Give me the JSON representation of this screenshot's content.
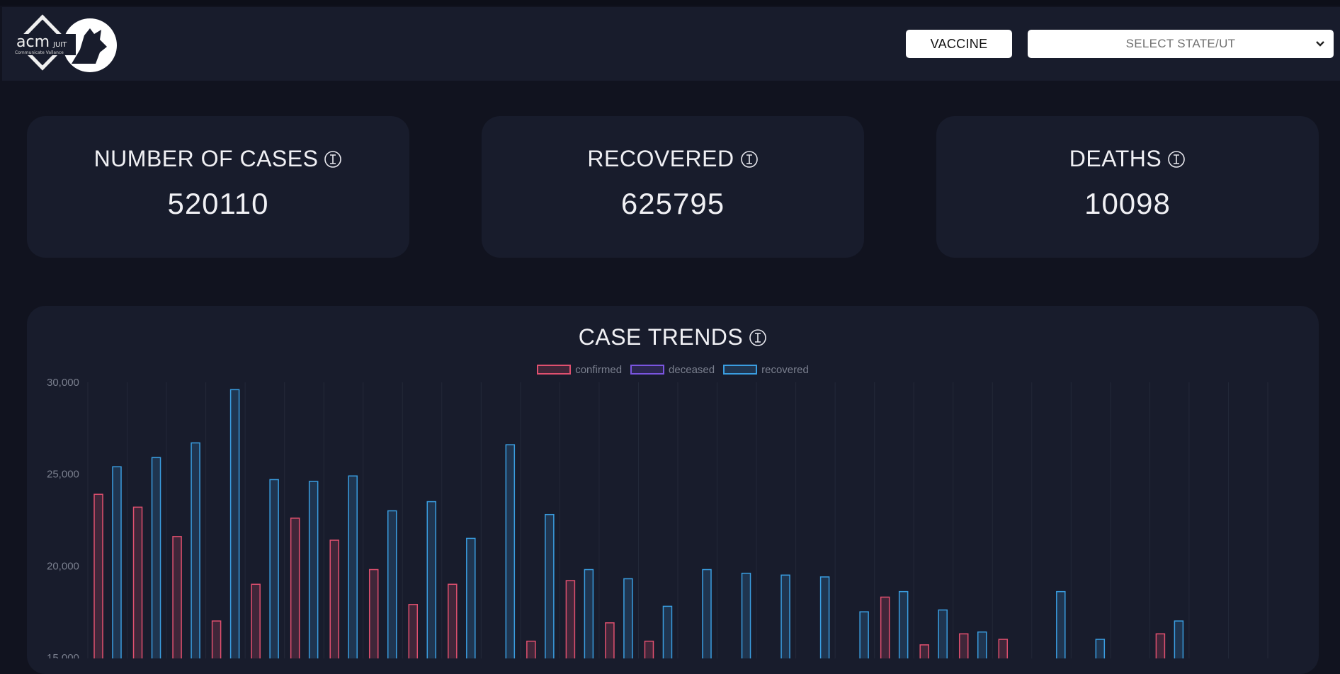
{
  "header": {
    "logo_text": "acm JUIT Communicate Vallance",
    "vaccine_label": "VACCINE",
    "state_select": {
      "selected": "SELECT STATE/UT",
      "icon": "chevron-down-icon"
    }
  },
  "stats": [
    {
      "title": "NUMBER OF CASES",
      "value": "520110",
      "icon": "info-icon"
    },
    {
      "title": "RECOVERED",
      "value": "625795",
      "icon": "info-icon"
    },
    {
      "title": "DEATHS",
      "value": "10098",
      "icon": "info-icon"
    }
  ],
  "colors": {
    "confirmed": "#e0506f",
    "deceased": "#7a55e0",
    "recovered": "#3a9de0"
  },
  "chart": {
    "title": "CASE TRENDS",
    "legend": [
      "confirmed",
      "deceased",
      "recovered"
    ]
  },
  "chart_data": {
    "type": "bar",
    "title": "CASE TRENDS",
    "yticks": [
      "30,000",
      "25,000",
      "20,000",
      "15,000"
    ],
    "ylim": [
      15000,
      30000
    ],
    "grid": true,
    "legend_position": "top",
    "series": [
      {
        "name": "confirmed",
        "values": [
          23900,
          23200,
          21600,
          17000,
          19000,
          22600,
          21400,
          19800,
          17900,
          19000,
          null,
          15900,
          19200,
          16900,
          15900,
          null,
          null,
          null,
          null,
          null,
          18300,
          15700,
          16300,
          16000,
          null,
          null,
          null,
          16300,
          null,
          null
        ]
      },
      {
        "name": "deceased",
        "values": []
      },
      {
        "name": "recovered",
        "values": [
          25400,
          25900,
          26700,
          29600,
          24700,
          24600,
          24900,
          23000,
          23500,
          21500,
          26600,
          22800,
          19800,
          19300,
          17800,
          19800,
          19600,
          19500,
          19400,
          17500,
          18600,
          17600,
          16400,
          null,
          18600,
          16000,
          null,
          17000,
          null,
          null
        ]
      }
    ]
  }
}
